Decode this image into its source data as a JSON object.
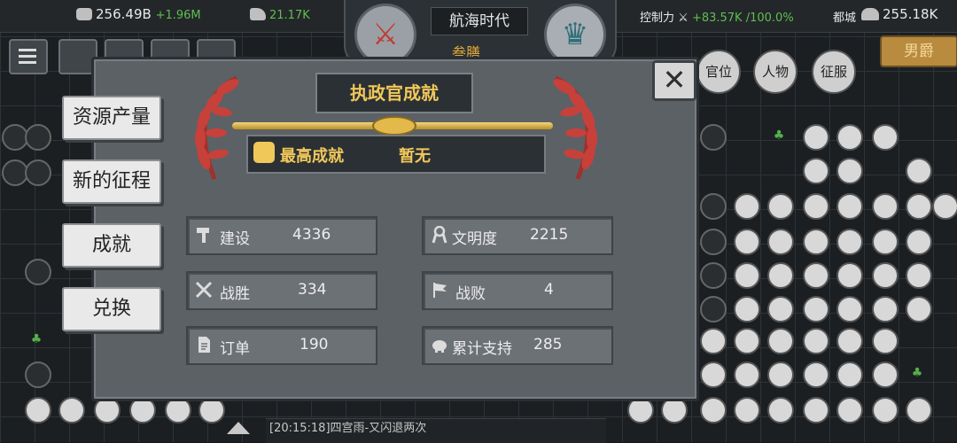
{
  "top_bar": {
    "coins": "256.49B",
    "coins_rate": "+1.96M",
    "power": "21.17K",
    "control_label": "控制力",
    "control_value": "+83.57K /100.0%",
    "capital_label": "都城",
    "population": "255.18K"
  },
  "center": {
    "era_title": "航海时代",
    "era_sub": "叁膳",
    "left_icon": "crossed-swords-icon",
    "right_icon": "crown-icon"
  },
  "rank_button": "男爵",
  "right_buttons": [
    "官位",
    "人物",
    "征服"
  ],
  "side_menu": [
    "资源产量",
    "新的征程",
    "成就",
    "兑换"
  ],
  "modal": {
    "title": "执政官成就",
    "best_label": "最高成就",
    "best_value": "暂无",
    "close_symbol": "✕",
    "stats": [
      {
        "icon": "hammer-icon",
        "label": "建设",
        "value": "4336"
      },
      {
        "icon": "ribbon-icon",
        "label": "文明度",
        "value": "2215"
      },
      {
        "icon": "crossed-swords-icon",
        "label": "战胜",
        "value": "334"
      },
      {
        "icon": "flag-icon",
        "label": "战败",
        "value": "4"
      },
      {
        "icon": "document-icon",
        "label": "订单",
        "value": "190"
      },
      {
        "icon": "piggy-bank-icon",
        "label": "累计支持",
        "value": "285"
      }
    ]
  },
  "chat": "[20:15:18]四宫雨-又闪退两次",
  "colors": {
    "gold": "#f0c85a",
    "green": "#5fbf4e",
    "laurel_red": "#c8403a",
    "panel": "#5c6166"
  }
}
